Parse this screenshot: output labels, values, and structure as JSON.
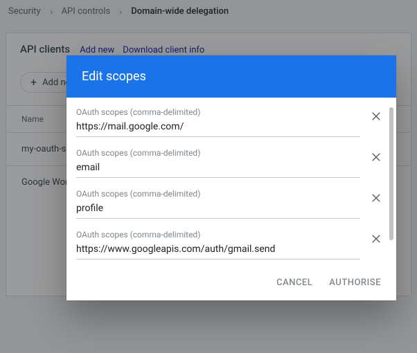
{
  "breadcrumb": {
    "a": "Security",
    "b": "API controls",
    "c": "Domain-wide delegation"
  },
  "panel": {
    "title": "API clients",
    "link_add": "Add new",
    "link_download": "Download client info"
  },
  "addbtn": {
    "label": "Add new"
  },
  "table": {
    "col_name": "Name",
    "rows": [
      "my-oauth-service-account",
      "Google Workspace"
    ]
  },
  "modal": {
    "title": "Edit scopes",
    "field_label": "OAuth scopes (comma-delimited)",
    "scopes": [
      "https://mail.google.com/",
      "email",
      "profile",
      "https://www.googleapis.com/auth/gmail.send"
    ],
    "cancel": "CANCEL",
    "authorise": "AUTHORISE"
  }
}
